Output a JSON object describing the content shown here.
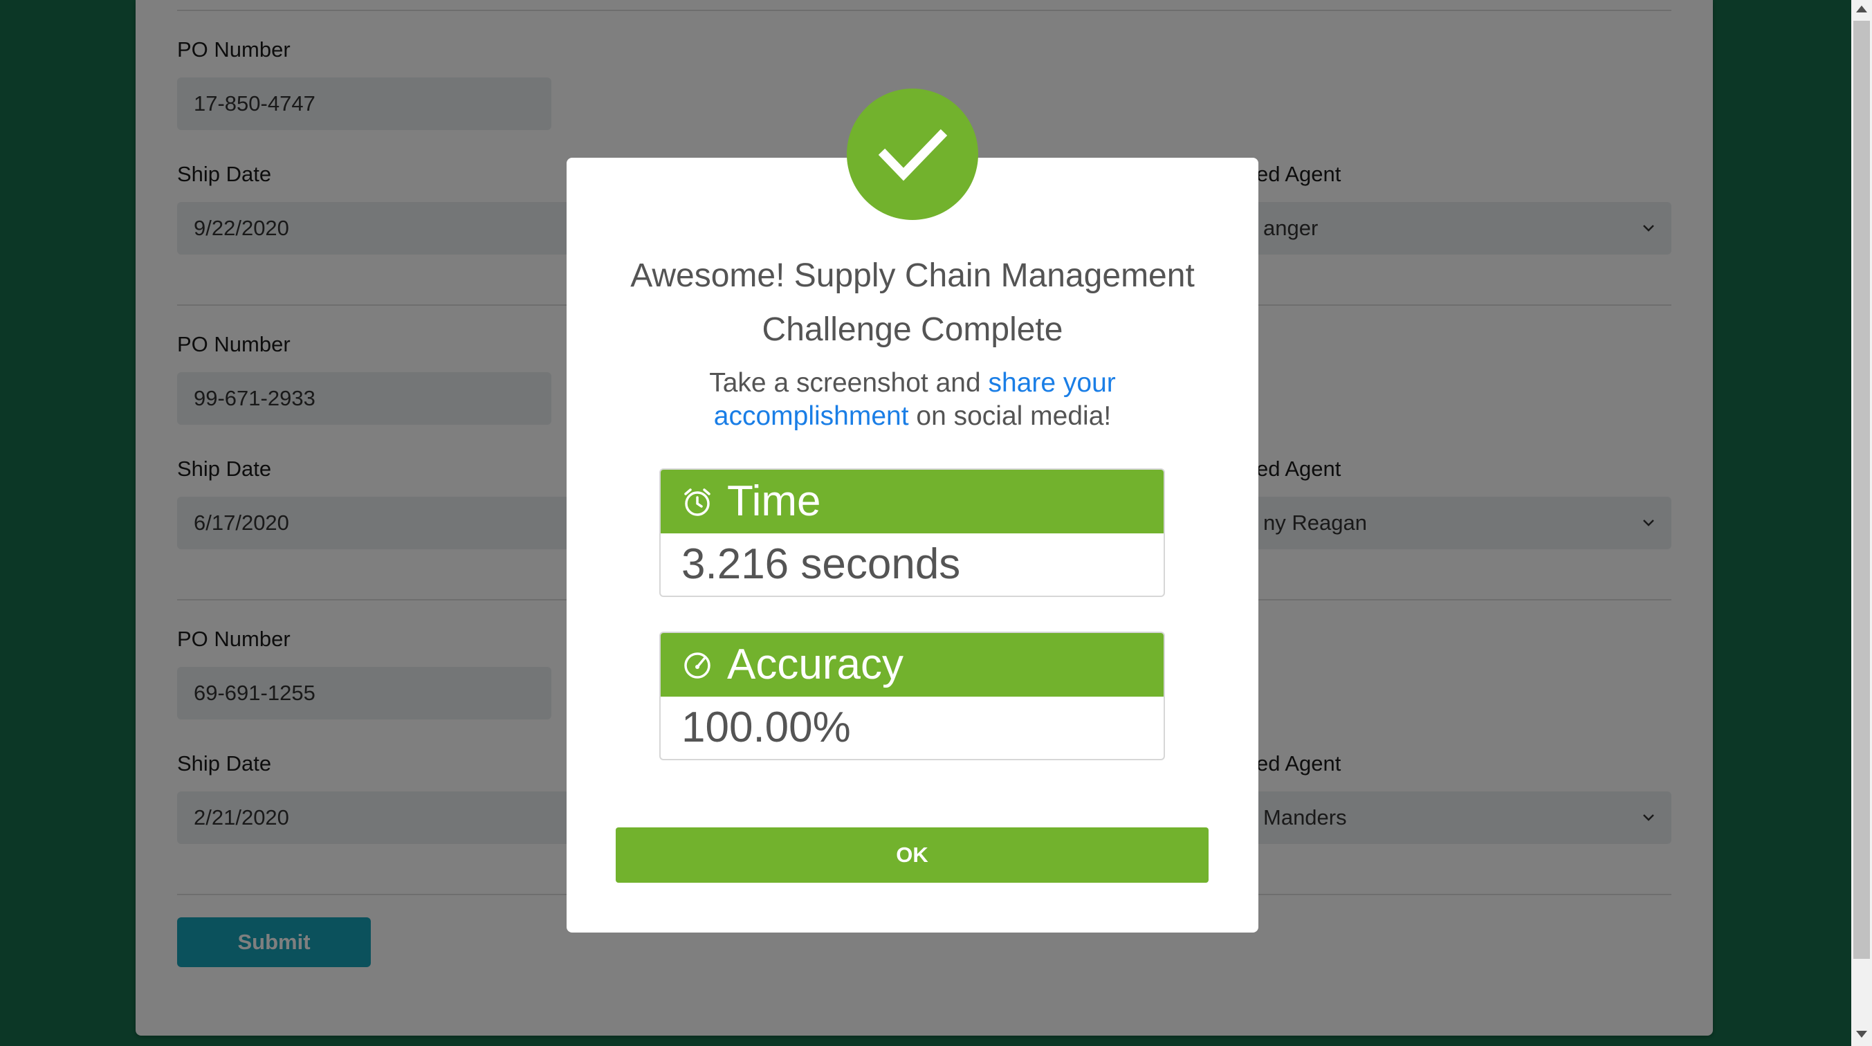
{
  "form": {
    "groups": [
      {
        "po_label": "PO Number",
        "po_value": "17-850-4747",
        "ship_label": "Ship Date",
        "ship_value": "9/22/2020",
        "agent_label": "ed Agent",
        "agent_value": "anger"
      },
      {
        "po_label": "PO Number",
        "po_value": "99-671-2933",
        "ship_label": "Ship Date",
        "ship_value": "6/17/2020",
        "agent_label": "ed Agent",
        "agent_value": "ny Reagan"
      },
      {
        "po_label": "PO Number",
        "po_value": "69-691-1255",
        "ship_label": "Ship Date",
        "ship_value": "2/21/2020",
        "agent_label": "ed Agent",
        "agent_value": "Manders"
      }
    ],
    "submit_label": "Submit"
  },
  "modal": {
    "title": "Awesome! Supply Chain Management Challenge Complete",
    "subtitle_before": "Take a screenshot and ",
    "subtitle_link": "share your accomplishment",
    "subtitle_after": " on social media!",
    "time_label": "Time",
    "time_value": "3.216 seconds",
    "accuracy_label": "Accuracy",
    "accuracy_value": "100.00%",
    "ok_label": "OK",
    "icons": [
      "check-icon",
      "alarm-clock-icon",
      "speedometer-icon"
    ]
  },
  "colors": {
    "page_background": "#186f4c",
    "accent_green": "#72b22d",
    "link_blue": "#1a7ee6",
    "submit_teal": "#17a2b8"
  }
}
